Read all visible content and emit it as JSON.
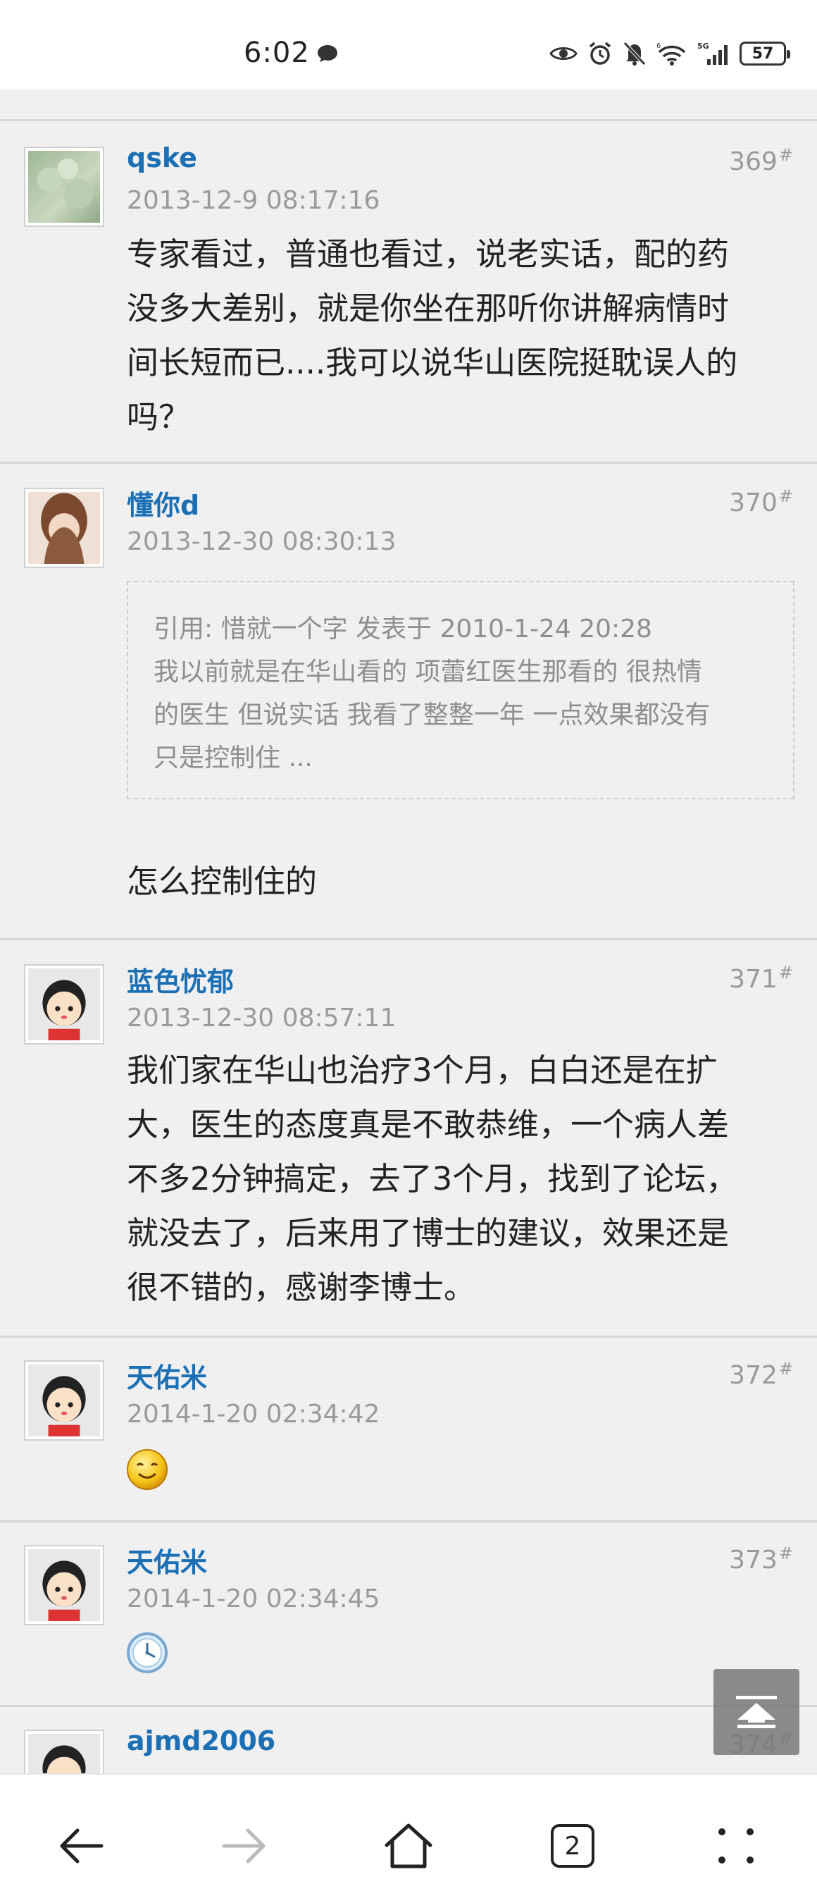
{
  "status_bar": {
    "time": "6:02",
    "battery": "57",
    "icons": [
      "message-icon",
      "eye-icon",
      "alarm-icon",
      "mute-bell-icon",
      "wifi-icon",
      "signal-5g-icon",
      "battery-icon"
    ]
  },
  "posts": [
    {
      "username": "qske",
      "floor": "369",
      "floor_mark": "#",
      "time": "2013-12-9 08:17:16",
      "lines": [
        "专家看过，普通也看过，说老实话，配的药",
        "没多大差别，就是你坐在那听你讲解病情时",
        "间长短而已....我可以说华山医院挺耽误人的",
        "吗？"
      ]
    },
    {
      "username": "懂你d",
      "floor": "370",
      "floor_mark": "#",
      "time": "2013-12-30 08:30:13",
      "quote_lines": [
        "引用: 惜就一个字 发表于 2010-1-24 20:28",
        "我以前就是在华山看的 项蕾红医生那看的 很热情",
        "的医生 但说实话 我看了整整一年 一点效果都没有",
        "只是控制住 ..."
      ],
      "reply": "怎么控制住的"
    },
    {
      "username": "蓝色忧郁",
      "floor": "371",
      "floor_mark": "#",
      "time": "2013-12-30 08:57:11",
      "lines": [
        "我们家在华山也治疗3个月，白白还是在扩",
        "大，医生的态度真是不敢恭维，一个病人差",
        "不多2分钟搞定，去了3个月，找到了论坛，",
        "就没去了，后来用了博士的建议，效果还是",
        "很不错的，感谢李博士。"
      ]
    },
    {
      "username": "天佑米",
      "floor": "372",
      "floor_mark": "#",
      "time": "2014-1-20 02:34:42",
      "emoji": "smile-emoji"
    },
    {
      "username": "天佑米",
      "floor": "373",
      "floor_mark": "#",
      "time": "2014-1-20 02:34:45",
      "emoji": "clock-emoji"
    },
    {
      "username": "ajmd2006",
      "floor": "374",
      "floor_mark": "#"
    }
  ],
  "bottom_nav": {
    "tab_count": "2",
    "icons": [
      "back-arrow-icon",
      "forward-arrow-icon",
      "home-icon",
      "tabs-icon",
      "more-icon"
    ]
  },
  "colors": {
    "username": "#1a6fb5",
    "meta": "#9a9a9a",
    "background": "#f1f1f1"
  }
}
